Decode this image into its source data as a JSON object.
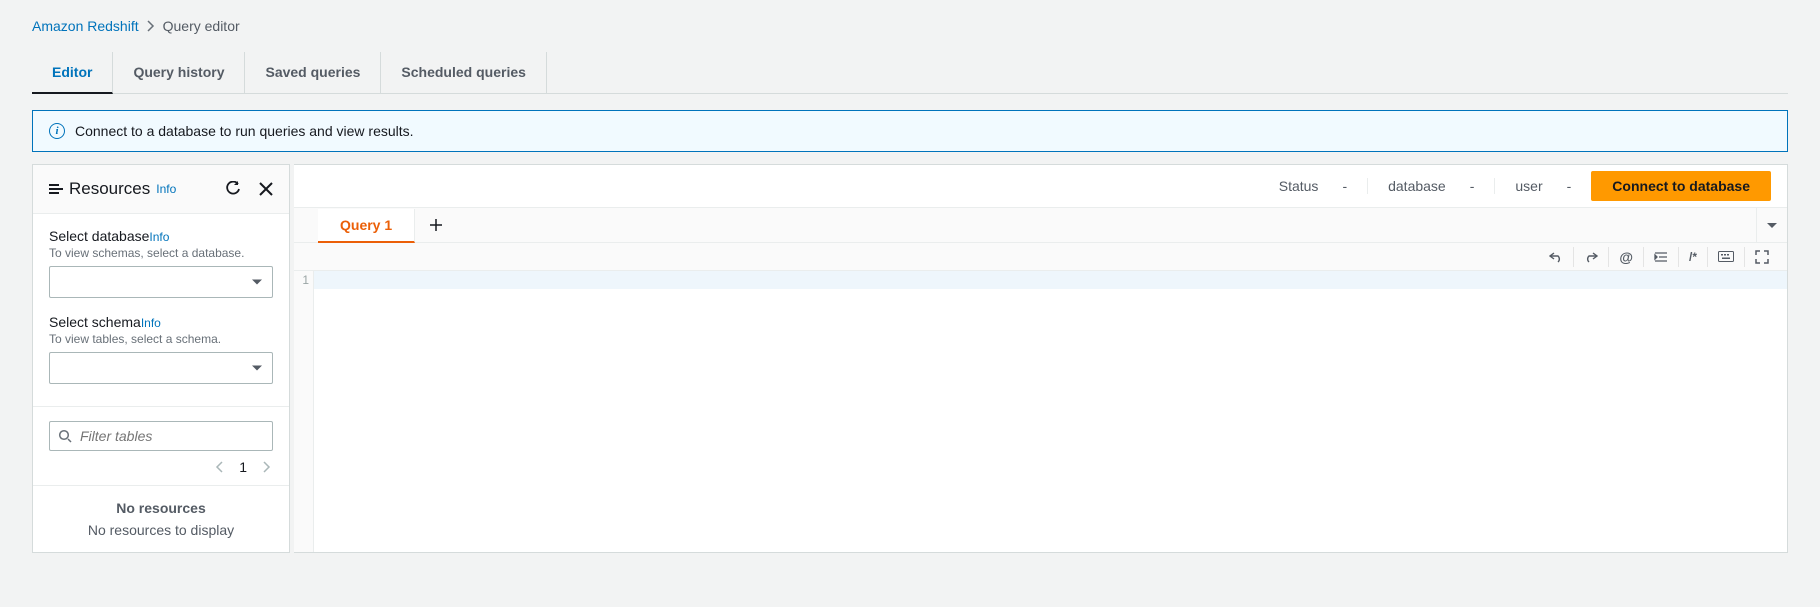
{
  "breadcrumb": {
    "root": "Amazon Redshift",
    "current": "Query editor"
  },
  "tabs": {
    "editor": "Editor",
    "history": "Query history",
    "saved": "Saved queries",
    "scheduled": "Scheduled queries"
  },
  "alert": {
    "message": "Connect to a database to run queries and view results."
  },
  "sidebar": {
    "title": "Resources",
    "info": "Info",
    "db": {
      "label": "Select database",
      "info": "Info",
      "desc": "To view schemas, select a database."
    },
    "schema": {
      "label": "Select schema",
      "info": "Info",
      "desc": "To view tables, select a schema."
    },
    "filter_placeholder": "Filter tables",
    "pager": {
      "page": "1"
    },
    "noresources": {
      "title": "No resources",
      "sub": "No resources to display"
    }
  },
  "conn": {
    "status_label": "Status",
    "status_value": "-",
    "db_label": "database",
    "db_value": "-",
    "user_label": "user",
    "user_value": "-",
    "button": "Connect to database"
  },
  "query_tab": {
    "label": "Query 1"
  },
  "editor": {
    "line1": "1"
  },
  "toolbar": {
    "at": "@",
    "comment": "/*"
  }
}
